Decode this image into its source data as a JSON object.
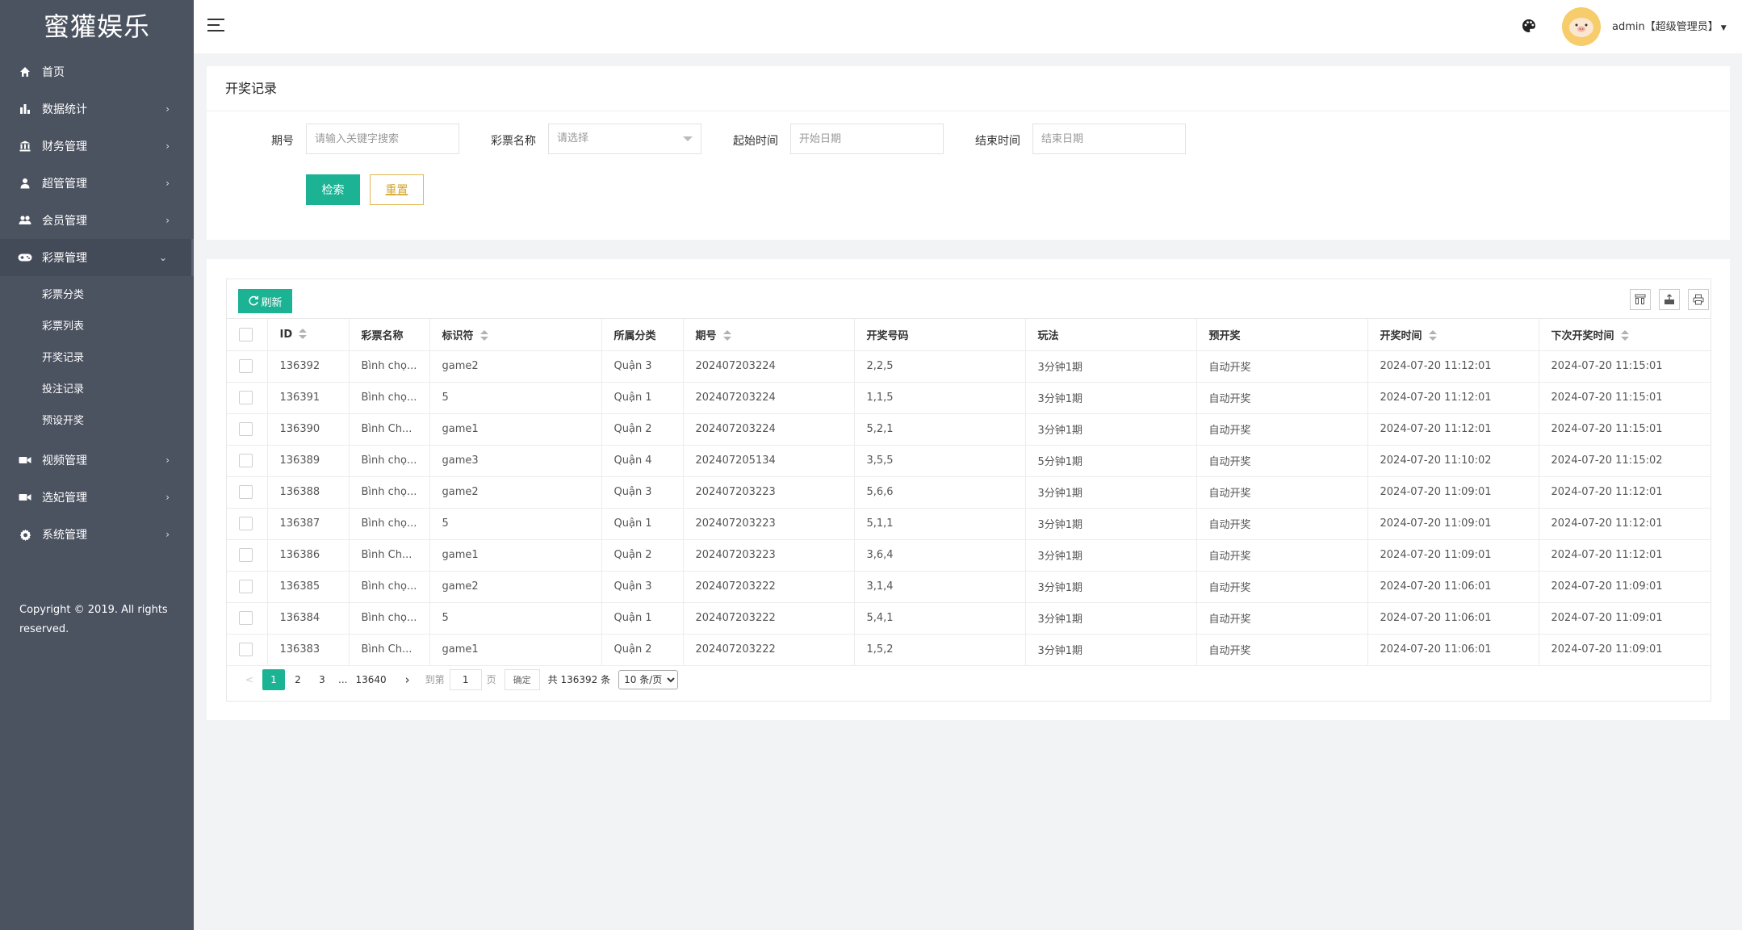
{
  "app": {
    "logo": "蜜獾娱乐"
  },
  "sidebar": {
    "items": [
      {
        "label": "首页",
        "icon": "home-icon"
      },
      {
        "label": "数据统计",
        "icon": "bar-chart-icon"
      },
      {
        "label": "财务管理",
        "icon": "bank-icon"
      },
      {
        "label": "超管管理",
        "icon": "user-icon"
      },
      {
        "label": "会员管理",
        "icon": "users-icon"
      },
      {
        "label": "彩票管理",
        "icon": "gamepad-icon"
      },
      {
        "label": "视频管理",
        "icon": "video-icon"
      },
      {
        "label": "选妃管理",
        "icon": "video-icon"
      },
      {
        "label": "系统管理",
        "icon": "gear-icon"
      }
    ],
    "submenu": [
      "彩票分类",
      "彩票列表",
      "开奖记录",
      "投注记录",
      "预设开奖"
    ],
    "copyright": "Copyright © 2019. All rights reserved."
  },
  "header": {
    "user": "admin【超级管理员】"
  },
  "search": {
    "title": "开奖记录",
    "issue_label": "期号",
    "issue_placeholder": "请输入关键字搜索",
    "lottery_label": "彩票名称",
    "lottery_placeholder": "请选择",
    "start_label": "起始时间",
    "start_placeholder": "开始日期",
    "end_label": "结束时间",
    "end_placeholder": "结束日期",
    "search_btn": "检索",
    "reset_btn": "重置"
  },
  "table": {
    "refresh_label": "刷新",
    "columns": [
      "ID",
      "彩票名称",
      "标识符",
      "所属分类",
      "期号",
      "开奖号码",
      "玩法",
      "预开奖",
      "开奖时间",
      "下次开奖时间"
    ],
    "rows": [
      [
        "136392",
        "Bình chọ...",
        "game2",
        "Quận 3",
        "202407203224",
        "2,2,5",
        "3分钟1期",
        "自动开奖",
        "2024-07-20 11:12:01",
        "2024-07-20 11:15:01"
      ],
      [
        "136391",
        "Bình chọ...",
        "5",
        "Quận 1",
        "202407203224",
        "1,1,5",
        "3分钟1期",
        "自动开奖",
        "2024-07-20 11:12:01",
        "2024-07-20 11:15:01"
      ],
      [
        "136390",
        "Bình Ch...",
        "game1",
        "Quận 2",
        "202407203224",
        "5,2,1",
        "3分钟1期",
        "自动开奖",
        "2024-07-20 11:12:01",
        "2024-07-20 11:15:01"
      ],
      [
        "136389",
        "Bình chọ...",
        "game3",
        "Quận 4",
        "202407205134",
        "3,5,5",
        "5分钟1期",
        "自动开奖",
        "2024-07-20 11:10:02",
        "2024-07-20 11:15:02"
      ],
      [
        "136388",
        "Bình chọ...",
        "game2",
        "Quận 3",
        "202407203223",
        "5,6,6",
        "3分钟1期",
        "自动开奖",
        "2024-07-20 11:09:01",
        "2024-07-20 11:12:01"
      ],
      [
        "136387",
        "Bình chọ...",
        "5",
        "Quận 1",
        "202407203223",
        "5,1,1",
        "3分钟1期",
        "自动开奖",
        "2024-07-20 11:09:01",
        "2024-07-20 11:12:01"
      ],
      [
        "136386",
        "Bình Ch...",
        "game1",
        "Quận 2",
        "202407203223",
        "3,6,4",
        "3分钟1期",
        "自动开奖",
        "2024-07-20 11:09:01",
        "2024-07-20 11:12:01"
      ],
      [
        "136385",
        "Bình chọ...",
        "game2",
        "Quận 3",
        "202407203222",
        "3,1,4",
        "3分钟1期",
        "自动开奖",
        "2024-07-20 11:06:01",
        "2024-07-20 11:09:01"
      ],
      [
        "136384",
        "Bình chọ...",
        "5",
        "Quận 1",
        "202407203222",
        "5,4,1",
        "3分钟1期",
        "自动开奖",
        "2024-07-20 11:06:01",
        "2024-07-20 11:09:01"
      ],
      [
        "136383",
        "Bình Ch...",
        "game1",
        "Quận 2",
        "202407203222",
        "1,5,2",
        "3分钟1期",
        "自动开奖",
        "2024-07-20 11:06:01",
        "2024-07-20 11:09:01"
      ]
    ]
  },
  "pagination": {
    "pages": [
      "1",
      "2",
      "3"
    ],
    "ellipsis": "...",
    "last_page": "13640",
    "goto_label": "到第",
    "page_value": "1",
    "page_suffix": "页",
    "confirm": "确定",
    "total": "共 136392 条",
    "page_size": "10 条/页"
  },
  "colors": {
    "sidebar": "#4b5260",
    "accent": "#1bb394",
    "reset": "#e1b84f",
    "avatar": "#f7cc6a"
  }
}
